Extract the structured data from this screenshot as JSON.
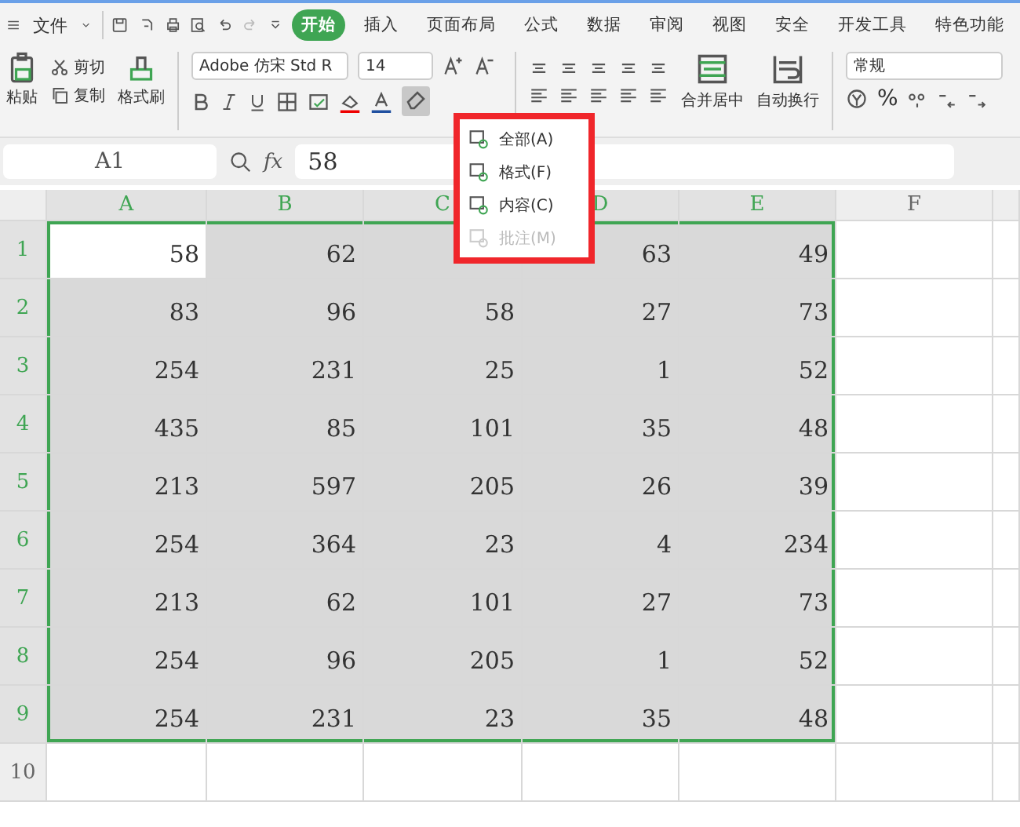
{
  "menu_bar": {
    "file_label": "文件",
    "tabs": [
      {
        "label": "开始",
        "selected": true
      },
      {
        "label": "插入",
        "selected": false
      },
      {
        "label": "页面布局",
        "selected": false
      },
      {
        "label": "公式",
        "selected": false
      },
      {
        "label": "数据",
        "selected": false
      },
      {
        "label": "审阅",
        "selected": false
      },
      {
        "label": "视图",
        "selected": false
      },
      {
        "label": "安全",
        "selected": false
      },
      {
        "label": "开发工具",
        "selected": false
      },
      {
        "label": "特色功能",
        "selected": false
      }
    ]
  },
  "ribbon": {
    "paste": "粘贴",
    "cut": "剪切",
    "copy": "复制",
    "format_painter": "格式刷",
    "font_name": "Adobe 仿宋 Std R",
    "font_size": "14",
    "merge": "合并居中",
    "wrap": "自动换行",
    "number_format": "常规",
    "percent": "%"
  },
  "formula_bar": {
    "cell_ref": "A1",
    "fx": "fx",
    "value": "58"
  },
  "clear_menu": {
    "items": [
      {
        "label": "全部(A)",
        "disabled": false
      },
      {
        "label": "格式(F)",
        "disabled": false
      },
      {
        "label": "内容(C)",
        "disabled": false
      },
      {
        "label": "批注(M)",
        "disabled": true
      }
    ]
  },
  "sheet": {
    "columns": [
      {
        "label": "A",
        "selected": true
      },
      {
        "label": "B",
        "selected": true
      },
      {
        "label": "C",
        "selected": true
      },
      {
        "label": "D",
        "selected": true
      },
      {
        "label": "E",
        "selected": true
      },
      {
        "label": "F",
        "selected": false
      }
    ],
    "rows": [
      {
        "label": "1",
        "selected": true,
        "cells": [
          "58",
          "62",
          null,
          "63",
          "49"
        ]
      },
      {
        "label": "2",
        "selected": true,
        "cells": [
          "83",
          "96",
          "58",
          "27",
          "73"
        ]
      },
      {
        "label": "3",
        "selected": true,
        "cells": [
          "254",
          "231",
          "25",
          "1",
          "52"
        ]
      },
      {
        "label": "4",
        "selected": true,
        "cells": [
          "435",
          "85",
          "101",
          "35",
          "48"
        ]
      },
      {
        "label": "5",
        "selected": true,
        "cells": [
          "213",
          "597",
          "205",
          "26",
          "39"
        ]
      },
      {
        "label": "6",
        "selected": true,
        "cells": [
          "254",
          "364",
          "23",
          "4",
          "234"
        ]
      },
      {
        "label": "7",
        "selected": true,
        "cells": [
          "213",
          "62",
          "101",
          "27",
          "73"
        ]
      },
      {
        "label": "8",
        "selected": true,
        "cells": [
          "254",
          "96",
          "205",
          "1",
          "52"
        ]
      },
      {
        "label": "9",
        "selected": true,
        "cells": [
          "254",
          "231",
          "23",
          "35",
          "48"
        ]
      },
      {
        "label": "10",
        "selected": false,
        "cells": []
      }
    ]
  }
}
